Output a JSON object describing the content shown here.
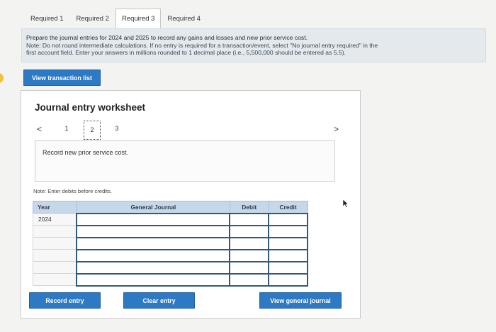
{
  "tabs": [
    "Required 1",
    "Required 2",
    "Required 3",
    "Required 4"
  ],
  "active_tab": 2,
  "instructions": {
    "line1": "Prepare the journal entries for 2024 and 2025 to record any gains and losses and new prior service cost.",
    "line2": "Note: Do not round intermediate calculations. If no entry is required for a transaction/event, select \"No journal entry required\" in the",
    "line3": "first account field. Enter your answers in millions rounded to 1 decimal place (i.e., 5,500,000 should be entered as 5.5)."
  },
  "view_transaction_list": "View transaction list",
  "worksheet": {
    "title": "Journal entry worksheet",
    "prev": "<",
    "next": ">",
    "pages": [
      "1",
      "2",
      "3"
    ],
    "current_page": "2",
    "description": "Record new prior service cost.",
    "note": "Note: Enter debits before credits.",
    "columns": {
      "year": "Year",
      "account": "General Journal",
      "debit": "Debit",
      "credit": "Credit"
    },
    "rows": [
      {
        "year": "2024"
      },
      {
        "year": ""
      },
      {
        "year": ""
      },
      {
        "year": ""
      },
      {
        "year": ""
      },
      {
        "year": ""
      }
    ],
    "record_entry": "Record entry",
    "clear_entry": "Clear entry",
    "view_general_journal": "View general journal"
  },
  "colors": {
    "accent": "#2d79c4",
    "header": "#c6d7ea",
    "instructions_bg": "#e4e9ee"
  }
}
